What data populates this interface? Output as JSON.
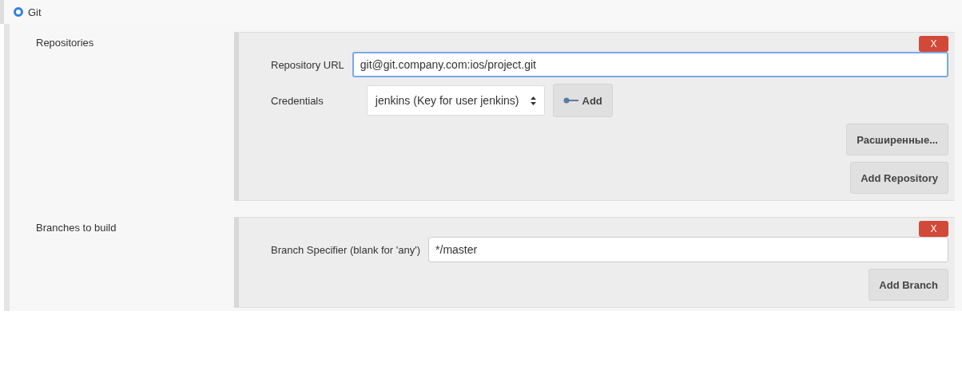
{
  "scm_option": {
    "label": "Git",
    "selected": true
  },
  "repositories": {
    "label": "Repositories",
    "entries": [
      {
        "url_label": "Repository URL",
        "url": "git@git.company.com:ios/project.git",
        "focused": true,
        "credentials_label": "Credentials",
        "credentials": "jenkins (Key for user jenkins)",
        "add_credentials": "Add",
        "delete": "X",
        "advanced": "Расширенные..."
      }
    ],
    "add_button": "Add Repository"
  },
  "branches": {
    "label": "Branches to build",
    "entries": [
      {
        "specifier_label": "Branch Specifier (blank for 'any')",
        "specifier": "*/master",
        "delete": "X"
      }
    ],
    "add_button": "Add Branch"
  }
}
